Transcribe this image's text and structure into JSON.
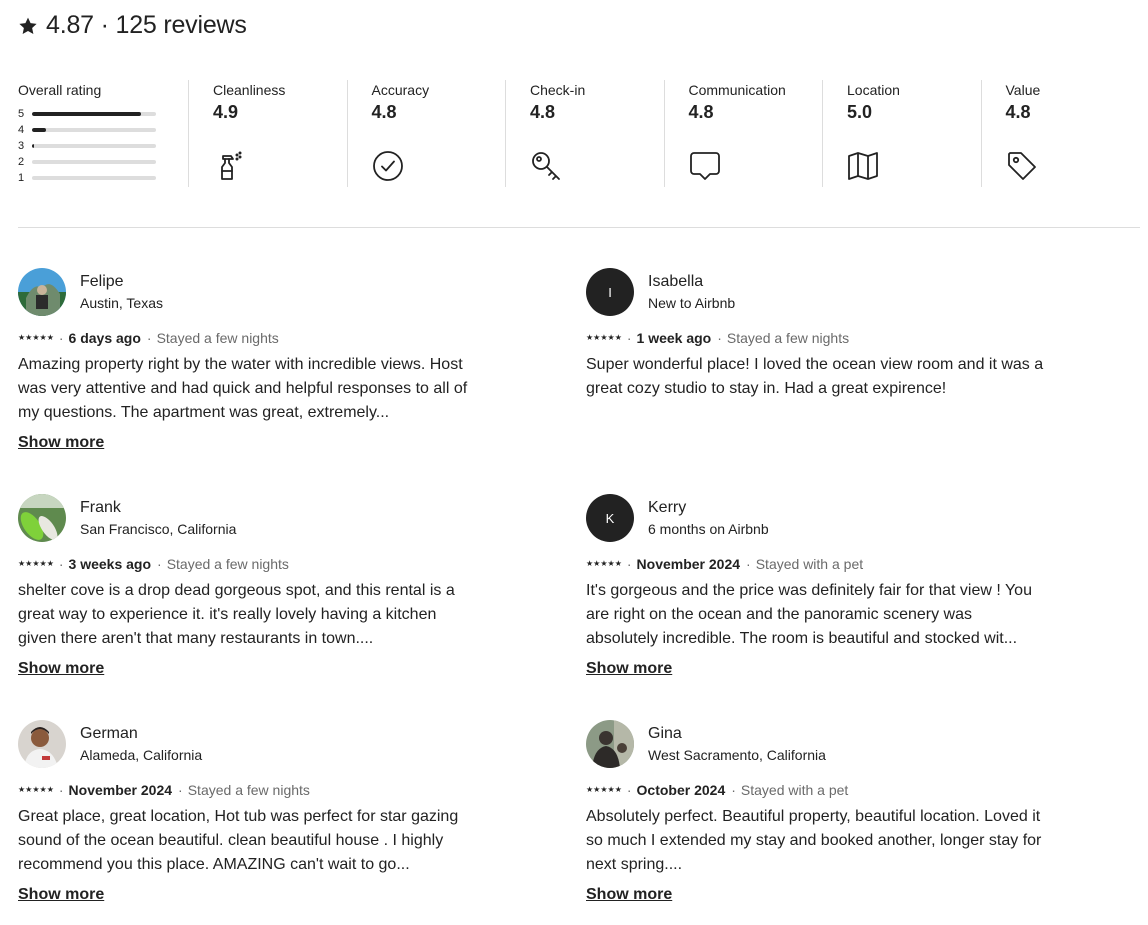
{
  "header": {
    "rating": "4.87",
    "separator": " · ",
    "reviews_count": "125 reviews"
  },
  "overall": {
    "label": "Overall rating",
    "distribution": [
      {
        "stars": "5",
        "fraction": 0.88
      },
      {
        "stars": "4",
        "fraction": 0.11
      },
      {
        "stars": "3",
        "fraction": 0.015
      },
      {
        "stars": "2",
        "fraction": 0
      },
      {
        "stars": "1",
        "fraction": 0
      }
    ]
  },
  "categories": [
    {
      "label": "Cleanliness",
      "value": "4.9",
      "icon": "spray-bottle-icon"
    },
    {
      "label": "Accuracy",
      "value": "4.8",
      "icon": "check-circle-icon"
    },
    {
      "label": "Check-in",
      "value": "4.8",
      "icon": "key-icon"
    },
    {
      "label": "Communication",
      "value": "4.8",
      "icon": "chat-bubble-icon"
    },
    {
      "label": "Location",
      "value": "5.0",
      "icon": "map-icon"
    },
    {
      "label": "Value",
      "value": "4.8",
      "icon": "price-tag-icon"
    }
  ],
  "reviews": [
    {
      "name": "Felipe",
      "subtitle": "Austin, Texas",
      "stars": "★★★★★",
      "date": "6 days ago",
      "stay": "Stayed a few nights",
      "text": "Amazing property right by the water with incredible views. Host was very attentive and had quick and helpful responses to all of my questions. The apartment was great, extremely...",
      "show_more": "Show more",
      "avatar": "photo"
    },
    {
      "name": "Isabella",
      "subtitle": "New to Airbnb",
      "stars": "★★★★★",
      "date": "1 week ago",
      "stay": "Stayed a few nights",
      "text": "Super wonderful place! I loved the ocean view room and it was a great cozy studio to stay in. Had a great expirence!",
      "show_more": "",
      "avatar": "initial",
      "initial": "I"
    },
    {
      "name": "Frank",
      "subtitle": "San Francisco, California",
      "stars": "★★★★★",
      "date": "3 weeks ago",
      "stay": "Stayed a few nights",
      "text": "shelter cove is a drop dead gorgeous spot, and this rental is a great way to experience it. it's really lovely having a kitchen given there aren't that many restaurants in town....",
      "show_more": "Show more",
      "avatar": "photo"
    },
    {
      "name": "Kerry",
      "subtitle": "6 months on Airbnb",
      "stars": "★★★★★",
      "date": "November 2024",
      "stay": "Stayed with a pet",
      "text": "It's gorgeous and the price was definitely fair for that view ! You are right on the ocean and the panoramic scenery was absolutely incredible. The room is beautiful and stocked wit...",
      "show_more": "Show more",
      "avatar": "initial",
      "initial": "K"
    },
    {
      "name": "German",
      "subtitle": "Alameda, California",
      "stars": "★★★★★",
      "date": "November 2024",
      "stay": "Stayed a few nights",
      "text": "Great place, great location, Hot tub was perfect for star gazing sound of the ocean beautiful. clean beautiful house . I highly recommend you this place. AMAZING can't wait to go...",
      "show_more": "Show more",
      "avatar": "photo"
    },
    {
      "name": "Gina",
      "subtitle": "West Sacramento, California",
      "stars": "★★★★★",
      "date": "October 2024",
      "stay": "Stayed with a pet",
      "text": "Absolutely perfect. Beautiful property, beautiful location. Loved it so much I extended my stay and booked another, longer stay for next spring....",
      "show_more": "Show more",
      "avatar": "photo"
    }
  ]
}
